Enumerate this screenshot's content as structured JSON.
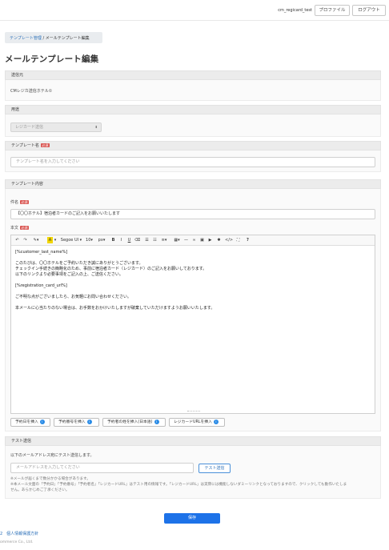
{
  "header": {
    "user": "cm_regicard_test",
    "profile_label": "プロファイル",
    "logout_label": "ログアウト"
  },
  "breadcrumb": {
    "parent": "テンプレート管理",
    "separator": "/",
    "current": "メールテンプレート編集"
  },
  "page_title": "メールテンプレート編集",
  "sender": {
    "heading": "送信元",
    "value": "CMレジカ送信ホテル①"
  },
  "usage": {
    "heading": "用途",
    "selected": "レジカード送信"
  },
  "template_name": {
    "heading": "テンプレート名",
    "required": "必須",
    "placeholder": "テンプレート名を入力してください"
  },
  "template_content": {
    "heading": "テンプレート内容",
    "subject_label": "件名",
    "required": "必須",
    "subject_value": "【〇〇ホテル】宿泊者カードのご記入をお願いいたします",
    "body_label": "本文"
  },
  "toolbar": {
    "font": "Segoe UI",
    "size": "10",
    "unit": "px"
  },
  "body_lines": [
    "[%customer_last_name%]",
    "このたびは、〇〇ホテルをご予約いただき誠にありがとうございます。",
    "チェックイン手続きの簡略化のため、事前に宿泊者カード（レジカード）のご記入をお願いしております。",
    "以下のリンクより必要事項をご記入の上、ご送信ください。",
    "[%registration_card_url%]",
    "ご不明な点がございましたら、お気軽にお問い合わせください。",
    "本メールに心当たりのない場合は、お手数をおかけいたしますが破棄していただけますようお願いいたします。"
  ],
  "insert_buttons": [
    "予約日を挿入",
    "予約番号を挿入",
    "予約者の姓を挿入(日本語)",
    "レジカードURLを挿入"
  ],
  "test_send": {
    "heading": "テスト送信",
    "instruction": "以下のメールアドレス宛にテスト送信します。",
    "placeholder": "メールアドレスを入力してください",
    "button": "テスト送信",
    "note1": "※メールが届くまで数分かかる場合があります。",
    "note2": "※本メール文面の「予約日」「予約番号」「予約者名」「レジカードURL」はテスト用の情報です。「レジカードURL」は実際には機能しないダミーリンクとなっておりますので、クリックしても動作いたしま",
    "note3": "せん。あらかじめご了承ください。"
  },
  "save_label": "保存",
  "footer": {
    "link": "2　個人情報保護方針",
    "copyright": "ommerce Co., Ltd."
  }
}
